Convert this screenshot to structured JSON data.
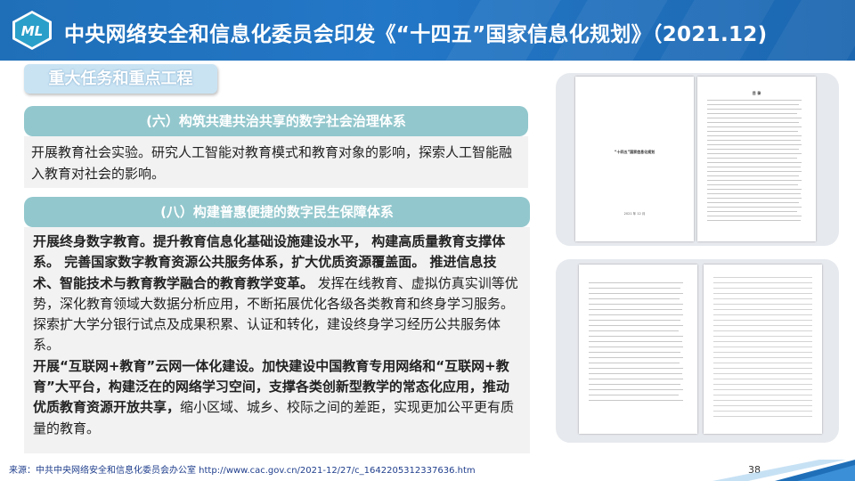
{
  "header": {
    "logo_text": "ML",
    "title": "中央网络安全和信息化委员会印发《“十四五”国家信息化规划》（2021.12)"
  },
  "section_tag": "重大任务和重点工程",
  "section6": {
    "heading": "(六）构筑共建共治共享的数字社会治理体系",
    "body": "开展教育社会实验。研究人工智能对教育模式和教育对象的影响，探索人工智能融入教育对社会的影响。"
  },
  "section8": {
    "heading": "(八）构建普惠便捷的数字民生保障体系",
    "p1_bold": "开展终身数字教育。提升教育信息化基础设施建设水平， 构建高质量教育支撑体系。 完善国家数字教育资源公共服务体系，扩大优质资源覆盖面。 推进信息技术、智能技术与教育教学融合的教育教学变革。",
    "p1_normal": " 发挥在线教育、虚拟仿真实训等优势，深化教育领域大数据分析应用，不断拓展优化各级各类教育和终身学习服务。 探索扩大学分银行试点及成果积累、认证和转化，建设终身学习经历公共服务体系。",
    "p2_bold": "开展“互联网+教育”云网一体化建设。加快建设中国教育专用网络和“互联网+教育”大平台，构建泛在的网络学习空间，支撑各类创新型教学的常态化应用，推动优质教育资源开放共享，",
    "p2_normal": "缩小区域、城乡、校际之间的差距，实现更加公平更有质量的教育。"
  },
  "doc_preview": {
    "cover_title": "“十四五”国家信息化规划",
    "cover_date": "2021 年 12 月",
    "toc_title": "目 录"
  },
  "footer": {
    "source": "来源：中共中央网络安全和信息化委员会办公室 http://www.cac.gov.cn/2021-12/27/c_1642205312337636.htm",
    "page_number": "38"
  },
  "colors": {
    "header_blue": "#1f6fb8",
    "bar_teal": "#92c7cd",
    "tag_blue": "#c9e3f3",
    "text_box": "#f2f2f2"
  }
}
